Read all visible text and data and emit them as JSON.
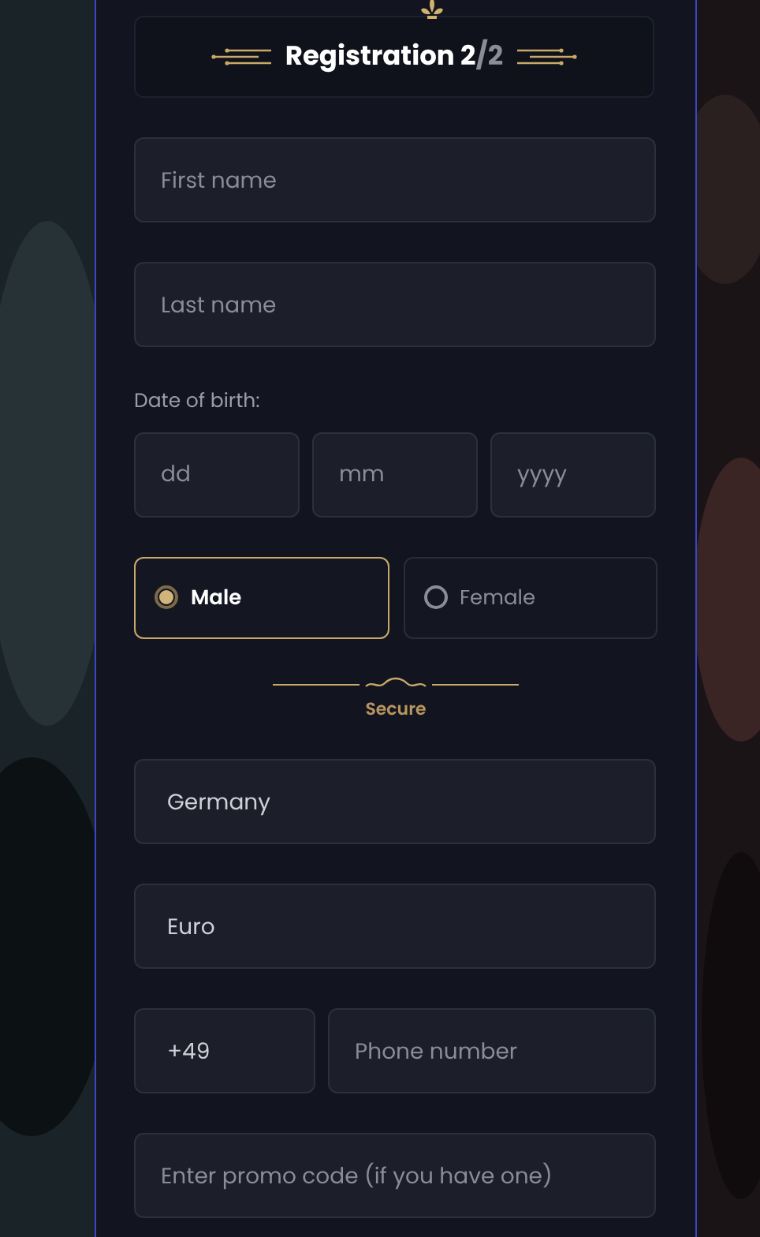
{
  "header": {
    "title": "Registration 2",
    "step_total": "/2"
  },
  "name_fields": [
    {
      "placeholder": "First name"
    },
    {
      "placeholder": "Last name"
    }
  ],
  "date_of_birth": {
    "label": "Date of birth:",
    "fields": [
      {
        "placeholder": "dd"
      },
      {
        "placeholder": "mm"
      },
      {
        "placeholder": "yyyy"
      }
    ]
  },
  "gender": [
    {
      "label": "Male",
      "selected": true
    },
    {
      "label": "Female",
      "selected": false
    }
  ],
  "divider": {
    "label": "Secure"
  },
  "selects": [
    {
      "value": "Germany"
    },
    {
      "value": "Euro"
    }
  ],
  "phone": {
    "code": "+49",
    "placeholder": "Phone number"
  },
  "promo": {
    "placeholder": "Enter promo code (if you have one)"
  }
}
